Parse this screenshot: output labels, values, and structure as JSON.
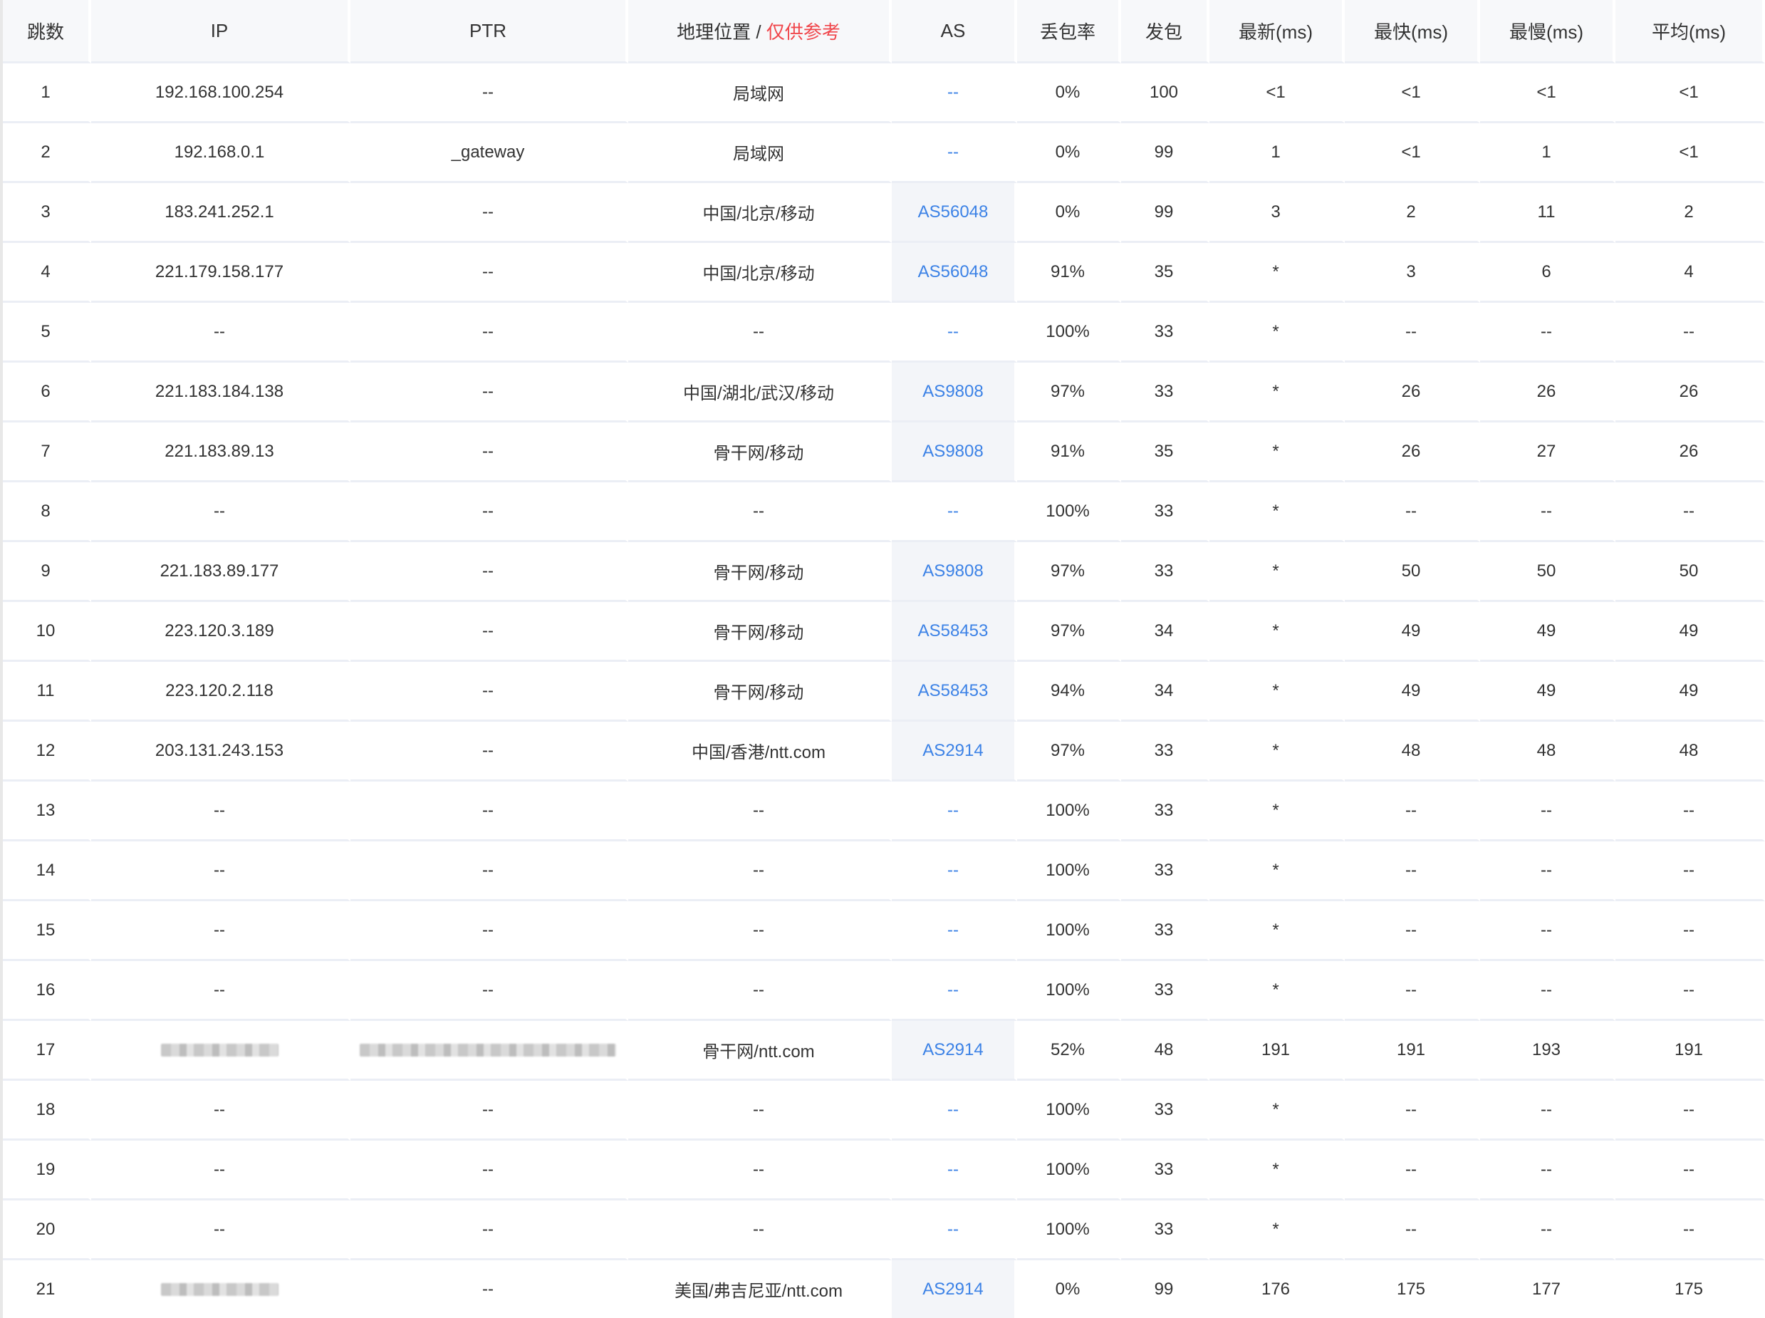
{
  "table": {
    "headers": {
      "hop": "跳数",
      "ip": "IP",
      "ptr": "PTR",
      "geo": "地理位置",
      "geo_sep": " / ",
      "geo_note": "仅供参考",
      "as": "AS",
      "loss": "丢包率",
      "sent": "发包",
      "last": "最新(ms)",
      "best": "最快(ms)",
      "worst": "最慢(ms)",
      "avg": "平均(ms)"
    },
    "rows": [
      {
        "hop": "1",
        "ip": "192.168.100.254",
        "ptr": "--",
        "geo": "局域网",
        "as": "--",
        "loss": "0%",
        "sent": "100",
        "last": "<1",
        "best": "<1",
        "worst": "<1",
        "avg": "<1"
      },
      {
        "hop": "2",
        "ip": "192.168.0.1",
        "ptr": "_gateway",
        "geo": "局域网",
        "as": "--",
        "loss": "0%",
        "sent": "99",
        "last": "1",
        "best": "<1",
        "worst": "1",
        "avg": "<1"
      },
      {
        "hop": "3",
        "ip": "183.241.252.1",
        "ptr": "--",
        "geo": "中国/北京/移动",
        "as": "AS56048",
        "loss": "0%",
        "sent": "99",
        "last": "3",
        "best": "2",
        "worst": "11",
        "avg": "2"
      },
      {
        "hop": "4",
        "ip": "221.179.158.177",
        "ptr": "--",
        "geo": "中国/北京/移动",
        "as": "AS56048",
        "loss": "91%",
        "sent": "35",
        "last": "*",
        "best": "3",
        "worst": "6",
        "avg": "4"
      },
      {
        "hop": "5",
        "ip": "--",
        "ptr": "--",
        "geo": "--",
        "as": "--",
        "loss": "100%",
        "sent": "33",
        "last": "*",
        "best": "--",
        "worst": "--",
        "avg": "--"
      },
      {
        "hop": "6",
        "ip": "221.183.184.138",
        "ptr": "--",
        "geo": "中国/湖北/武汉/移动",
        "as": "AS9808",
        "loss": "97%",
        "sent": "33",
        "last": "*",
        "best": "26",
        "worst": "26",
        "avg": "26"
      },
      {
        "hop": "7",
        "ip": "221.183.89.13",
        "ptr": "--",
        "geo": "骨干网/移动",
        "as": "AS9808",
        "loss": "91%",
        "sent": "35",
        "last": "*",
        "best": "26",
        "worst": "27",
        "avg": "26"
      },
      {
        "hop": "8",
        "ip": "--",
        "ptr": "--",
        "geo": "--",
        "as": "--",
        "loss": "100%",
        "sent": "33",
        "last": "*",
        "best": "--",
        "worst": "--",
        "avg": "--"
      },
      {
        "hop": "9",
        "ip": "221.183.89.177",
        "ptr": "--",
        "geo": "骨干网/移动",
        "as": "AS9808",
        "loss": "97%",
        "sent": "33",
        "last": "*",
        "best": "50",
        "worst": "50",
        "avg": "50"
      },
      {
        "hop": "10",
        "ip": "223.120.3.189",
        "ptr": "--",
        "geo": "骨干网/移动",
        "as": "AS58453",
        "loss": "97%",
        "sent": "34",
        "last": "*",
        "best": "49",
        "worst": "49",
        "avg": "49"
      },
      {
        "hop": "11",
        "ip": "223.120.2.118",
        "ptr": "--",
        "geo": "骨干网/移动",
        "as": "AS58453",
        "loss": "94%",
        "sent": "34",
        "last": "*",
        "best": "49",
        "worst": "49",
        "avg": "49"
      },
      {
        "hop": "12",
        "ip": "203.131.243.153",
        "ptr": "--",
        "geo": "中国/香港/ntt.com",
        "as": "AS2914",
        "loss": "97%",
        "sent": "33",
        "last": "*",
        "best": "48",
        "worst": "48",
        "avg": "48"
      },
      {
        "hop": "13",
        "ip": "--",
        "ptr": "--",
        "geo": "--",
        "as": "--",
        "loss": "100%",
        "sent": "33",
        "last": "*",
        "best": "--",
        "worst": "--",
        "avg": "--"
      },
      {
        "hop": "14",
        "ip": "--",
        "ptr": "--",
        "geo": "--",
        "as": "--",
        "loss": "100%",
        "sent": "33",
        "last": "*",
        "best": "--",
        "worst": "--",
        "avg": "--"
      },
      {
        "hop": "15",
        "ip": "--",
        "ptr": "--",
        "geo": "--",
        "as": "--",
        "loss": "100%",
        "sent": "33",
        "last": "*",
        "best": "--",
        "worst": "--",
        "avg": "--"
      },
      {
        "hop": "16",
        "ip": "--",
        "ptr": "--",
        "geo": "--",
        "as": "--",
        "loss": "100%",
        "sent": "33",
        "last": "*",
        "best": "--",
        "worst": "--",
        "avg": "--"
      },
      {
        "hop": "17",
        "ip": "",
        "ip_blurred": true,
        "ptr": "",
        "ptr_blurred": true,
        "geo": "骨干网/ntt.com",
        "as": "AS2914",
        "loss": "52%",
        "sent": "48",
        "last": "191",
        "best": "191",
        "worst": "193",
        "avg": "191"
      },
      {
        "hop": "18",
        "ip": "--",
        "ptr": "--",
        "geo": "--",
        "as": "--",
        "loss": "100%",
        "sent": "33",
        "last": "*",
        "best": "--",
        "worst": "--",
        "avg": "--"
      },
      {
        "hop": "19",
        "ip": "--",
        "ptr": "--",
        "geo": "--",
        "as": "--",
        "loss": "100%",
        "sent": "33",
        "last": "*",
        "best": "--",
        "worst": "--",
        "avg": "--"
      },
      {
        "hop": "20",
        "ip": "--",
        "ptr": "--",
        "geo": "--",
        "as": "--",
        "loss": "100%",
        "sent": "33",
        "last": "*",
        "best": "--",
        "worst": "--",
        "avg": "--"
      },
      {
        "hop": "21",
        "ip": "",
        "ip_blurred": true,
        "ptr": "--",
        "geo": "美国/弗吉尼亚/ntt.com",
        "as": "AS2914",
        "loss": "0%",
        "sent": "99",
        "last": "176",
        "best": "175",
        "worst": "177",
        "avg": "175"
      }
    ]
  },
  "colors": {
    "text": "#333333",
    "header_bg": "#f7f8fa",
    "as_link": "#3c82e6",
    "as_cell_bg": "#f3f5f9",
    "warning": "#f0464b",
    "row_divider": "#ebeef5"
  }
}
